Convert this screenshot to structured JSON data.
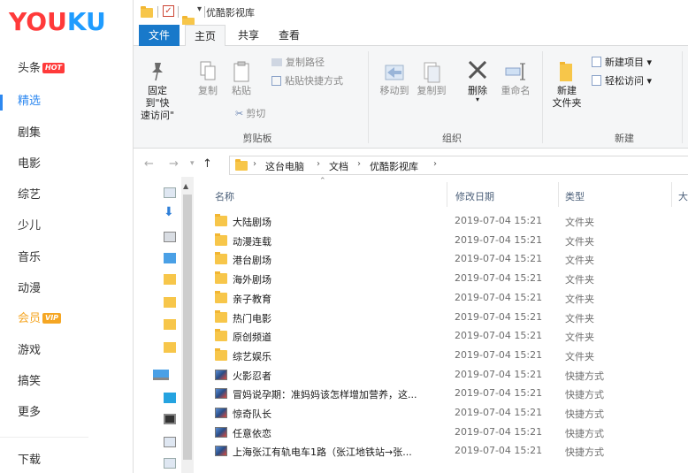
{
  "youku": {
    "logo_part1": "YOU",
    "logo_part2": "KU",
    "nav": [
      {
        "label": "头条",
        "badge": "HOT"
      },
      {
        "label": "精选",
        "active": true
      },
      {
        "label": "剧集"
      },
      {
        "label": "电影"
      },
      {
        "label": "综艺"
      },
      {
        "label": "少儿"
      },
      {
        "label": "音乐"
      },
      {
        "label": "动漫"
      },
      {
        "label": "会员",
        "badge": "VIP"
      },
      {
        "label": "游戏"
      },
      {
        "label": "搞笑"
      },
      {
        "label": "更多"
      },
      {
        "label": "下载"
      }
    ]
  },
  "window": {
    "title": "优酷影视库",
    "tabs": [
      "文件",
      "主页",
      "共享",
      "查看"
    ],
    "active_tab": "主页"
  },
  "ribbon": {
    "clipboard": {
      "label": "剪贴板",
      "pin_line1": "固定到\"快",
      "pin_line2": "速访问\"",
      "copy": "复制",
      "paste": "粘贴",
      "copy_path": "复制路径",
      "paste_shortcut": "粘贴快捷方式",
      "cut": "剪切"
    },
    "organize": {
      "label": "组织",
      "move_to": "移动到",
      "copy_to": "复制到",
      "delete": "删除",
      "rename": "重命名"
    },
    "new": {
      "label": "新建",
      "new_folder_line1": "新建",
      "new_folder_line2": "文件夹",
      "new_item": "新建项目 ▾",
      "easy_access": "轻松访问 ▾"
    }
  },
  "address": {
    "crumbs": [
      "这台电脑",
      "文档",
      "优酷影视库"
    ]
  },
  "columns": {
    "name": "名称",
    "date": "修改日期",
    "type": "类型",
    "size": "大"
  },
  "files": [
    {
      "name": "大陆剧场",
      "date": "2019-07-04 15:21",
      "type": "文件夹",
      "kind": "folder"
    },
    {
      "name": "动漫连载",
      "date": "2019-07-04 15:21",
      "type": "文件夹",
      "kind": "folder"
    },
    {
      "name": "港台剧场",
      "date": "2019-07-04 15:21",
      "type": "文件夹",
      "kind": "folder"
    },
    {
      "name": "海外剧场",
      "date": "2019-07-04 15:21",
      "type": "文件夹",
      "kind": "folder"
    },
    {
      "name": "亲子教育",
      "date": "2019-07-04 15:21",
      "type": "文件夹",
      "kind": "folder"
    },
    {
      "name": "热门电影",
      "date": "2019-07-04 15:21",
      "type": "文件夹",
      "kind": "folder"
    },
    {
      "name": "原创频道",
      "date": "2019-07-04 15:21",
      "type": "文件夹",
      "kind": "folder"
    },
    {
      "name": "综艺娱乐",
      "date": "2019-07-04 15:21",
      "type": "文件夹",
      "kind": "folder"
    },
    {
      "name": "火影忍者",
      "date": "2019-07-04 15:21",
      "type": "快捷方式",
      "kind": "shortcut"
    },
    {
      "name": "冒妈说孕期：准妈妈该怎样增加营养，这...",
      "date": "2019-07-04 15:21",
      "type": "快捷方式",
      "kind": "shortcut"
    },
    {
      "name": "惊奇队长",
      "date": "2019-07-04 15:21",
      "type": "快捷方式",
      "kind": "shortcut"
    },
    {
      "name": "任意依恋",
      "date": "2019-07-04 15:21",
      "type": "快捷方式",
      "kind": "shortcut"
    },
    {
      "name": "上海张江有轨电车1路（张江地铁站→张...",
      "date": "2019-07-04 15:21",
      "type": "快捷方式",
      "kind": "shortcut"
    }
  ],
  "colors": {
    "accent": "#1979ca",
    "youku_red": "#ff3a3a",
    "youku_blue": "#1f9cff",
    "active_nav": "#2d88f0",
    "folder": "#f7c64a"
  }
}
